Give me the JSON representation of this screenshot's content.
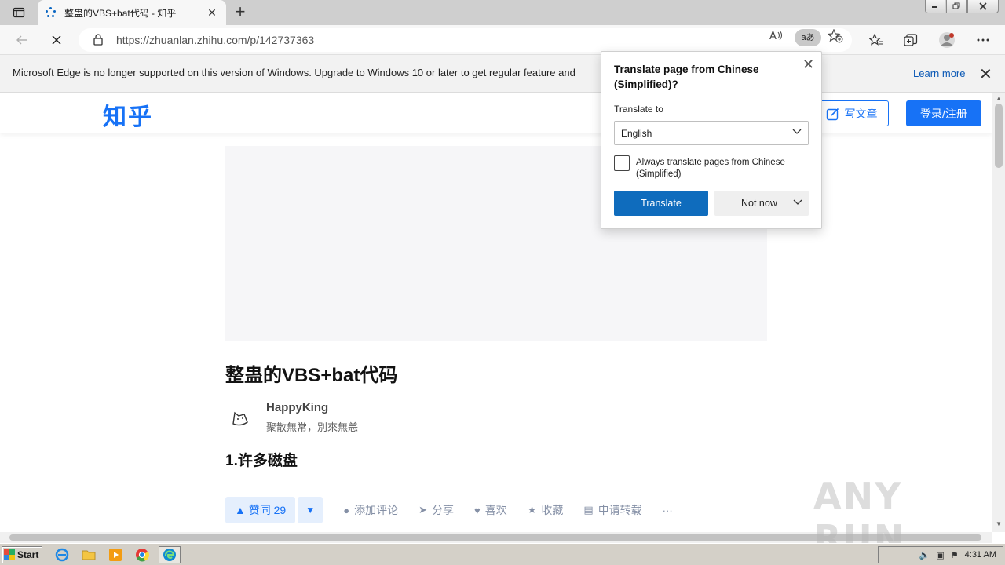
{
  "browser": {
    "tab_title": "整蛊的VBS+bat代码 - 知乎",
    "tab_close": "✕",
    "new_tab": "+",
    "url": "https://zhuanlan.zhihu.com/p/142737363",
    "translate_badge": "aあ",
    "read_aloud": "A⁴"
  },
  "notification": {
    "message": "Microsoft Edge is no longer supported on this version of Windows. Upgrade to Windows 10 or later to get regular feature and",
    "learn_more": "Learn more",
    "close": "✕"
  },
  "zhihu": {
    "logo": "知乎",
    "write_label": "写文章",
    "login_label": "登录/注册",
    "post_title": "整蛊的VBS+bat代码",
    "author_name": "HappyKing",
    "author_bio": "聚散無常，別來無恙",
    "section_heading": "1.许多磁盘",
    "vote_up": "▲ 赞同 29",
    "vote_down": "▼",
    "actions": [
      {
        "icon": "comment-icon",
        "glyph": "●",
        "label": "添加评论"
      },
      {
        "icon": "share-icon",
        "glyph": "➤",
        "label": "分享"
      },
      {
        "icon": "heart-icon",
        "glyph": "♥",
        "label": "喜欢"
      },
      {
        "icon": "star-icon",
        "glyph": "★",
        "label": "收藏"
      },
      {
        "icon": "repost-icon",
        "glyph": "▤",
        "label": "申请转载"
      },
      {
        "icon": "more-icon",
        "glyph": "···",
        "label": ""
      }
    ]
  },
  "translate_popup": {
    "heading": "Translate page from Chinese (Simplified)?",
    "close": "✕",
    "translate_to_label": "Translate to",
    "language": "English",
    "always_label": "Always translate pages from Chinese (Simplified)",
    "always_checked": false,
    "translate_button": "Translate",
    "not_now_button": "Not now"
  },
  "watermark": "ANY RUN",
  "taskbar": {
    "start_label": "Start",
    "clock": "4:31 AM"
  },
  "colors": {
    "zhihu_blue": "#1772f6",
    "edge_blue": "#0f6cbd",
    "link_blue": "#0a58b5"
  }
}
